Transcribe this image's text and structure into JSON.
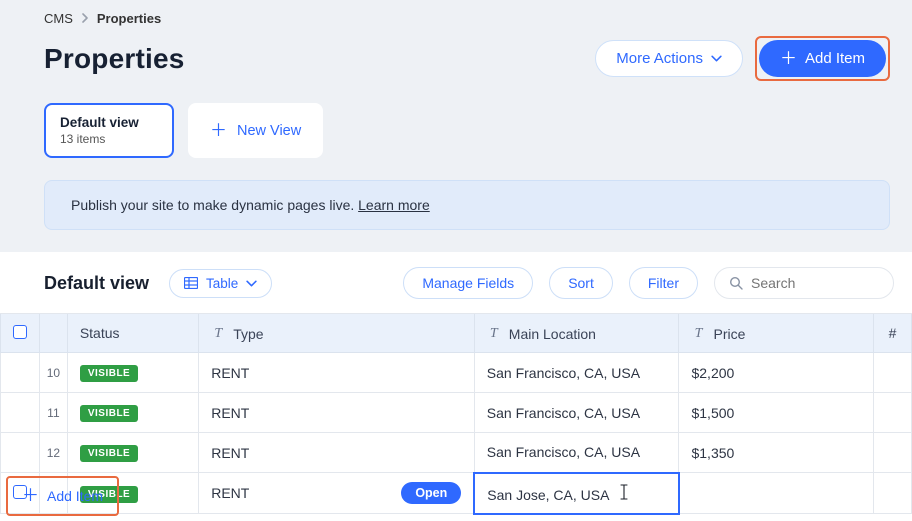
{
  "breadcrumb": {
    "root": "CMS",
    "current": "Properties"
  },
  "page": {
    "title": "Properties"
  },
  "actions": {
    "more": "More Actions",
    "add": "Add Item"
  },
  "views": {
    "active": {
      "name": "Default view",
      "sub": "13 items"
    },
    "newView": "New View"
  },
  "banner": {
    "text": "Publish your site to make dynamic pages live. ",
    "link": "Learn more"
  },
  "toolbar": {
    "viewTitle": "Default view",
    "mode": "Table",
    "manage": "Manage Fields",
    "sort": "Sort",
    "filter": "Filter",
    "searchPlaceholder": "Search"
  },
  "columns": {
    "status": "Status",
    "type": "Type",
    "loc": "Main Location",
    "price": "Price",
    "hash": "#"
  },
  "badge": "VISIBLE",
  "openChip": "Open",
  "rows": [
    {
      "num": "10",
      "type": "RENT",
      "loc": "San Francisco, CA, USA",
      "price": "$2,200"
    },
    {
      "num": "11",
      "type": "RENT",
      "loc": "San Francisco, CA, USA",
      "price": "$1,500"
    },
    {
      "num": "12",
      "type": "RENT",
      "loc": "San Francisco, CA, USA",
      "price": "$1,350"
    },
    {
      "num": "",
      "type": "RENT",
      "loc": "San Jose, CA, USA",
      "price": ""
    }
  ],
  "footer": {
    "addItem": "Add Item"
  }
}
